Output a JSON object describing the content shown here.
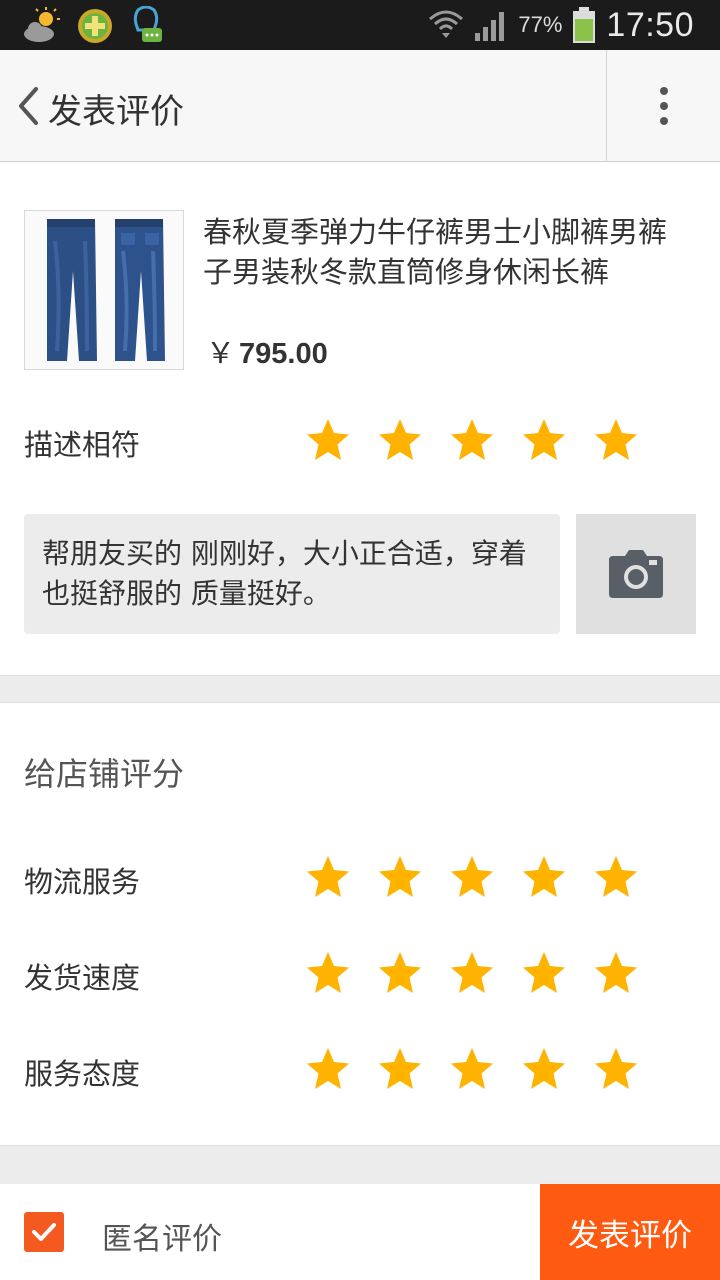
{
  "status_bar": {
    "battery_percent": "77%",
    "time": "17:50",
    "notification_icons": [
      "weather-icon",
      "plus-app-icon",
      "chat-bubble-icon"
    ]
  },
  "header": {
    "title": "发表评价"
  },
  "product": {
    "title": "春秋夏季弹力牛仔裤男士小脚裤男裤子男装秋冬款直筒修身休闲长裤",
    "currency": "￥",
    "price": "795.00",
    "image_icon": "jeans-thumbnail"
  },
  "description_rating": {
    "label": "描述相符",
    "stars": 5
  },
  "comment": {
    "text": " 帮朋友买的   刚刚好，大小正合适，穿着也挺舒服的  质量挺好。"
  },
  "shop_rating": {
    "title": "给店铺评分",
    "rows": [
      {
        "label": "物流服务",
        "stars": 5
      },
      {
        "label": "发货速度",
        "stars": 5
      },
      {
        "label": "服务态度",
        "stars": 5
      }
    ]
  },
  "footer": {
    "anonymous_label": "匿名评价",
    "anonymous_checked": true,
    "submit_label": "发表评价"
  },
  "colors": {
    "accent": "#ff5a12",
    "star": "#ffb300",
    "status_bar": "#1b1b1b"
  }
}
